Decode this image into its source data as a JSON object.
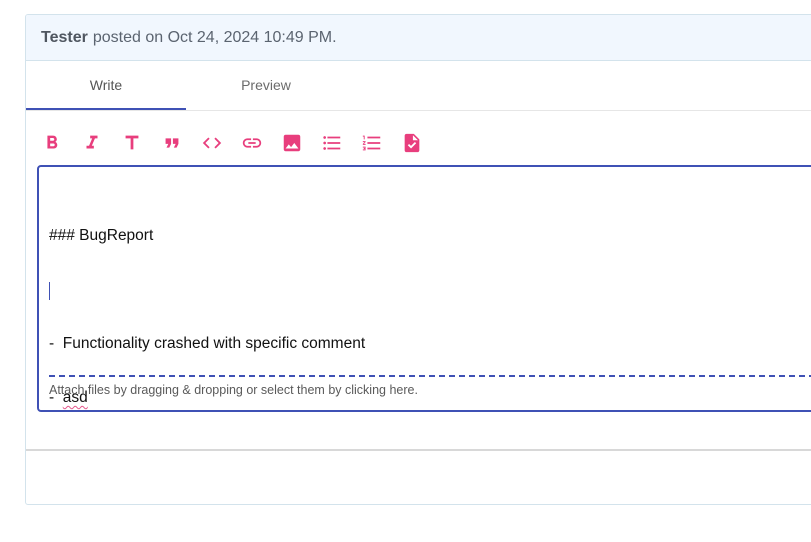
{
  "comment": {
    "author": "Tester",
    "meta": "posted on Oct 24, 2024 10:49 PM."
  },
  "tabs": [
    {
      "label": "Write",
      "active": true
    },
    {
      "label": "Preview",
      "active": false
    }
  ],
  "toolbar": [
    {
      "icon": "bold-icon"
    },
    {
      "icon": "italic-icon"
    },
    {
      "icon": "heading-icon"
    },
    {
      "icon": "quote-icon"
    },
    {
      "icon": "code-icon"
    },
    {
      "icon": "link-icon"
    },
    {
      "icon": "image-icon"
    },
    {
      "icon": "bulleted-list-icon"
    },
    {
      "icon": "numbered-list-icon"
    },
    {
      "icon": "task-list-icon"
    }
  ],
  "editor": {
    "lines": [
      "### BugReport",
      "",
      "-  Functionality crashed with specific comment",
      "-  asd"
    ],
    "attach_hint": "Attach files by dragging & dropping or select them by clicking here."
  },
  "colors": {
    "accent": "#3f51b5",
    "icon": "#e83e7d",
    "header_bg": "#f1f7fe"
  }
}
